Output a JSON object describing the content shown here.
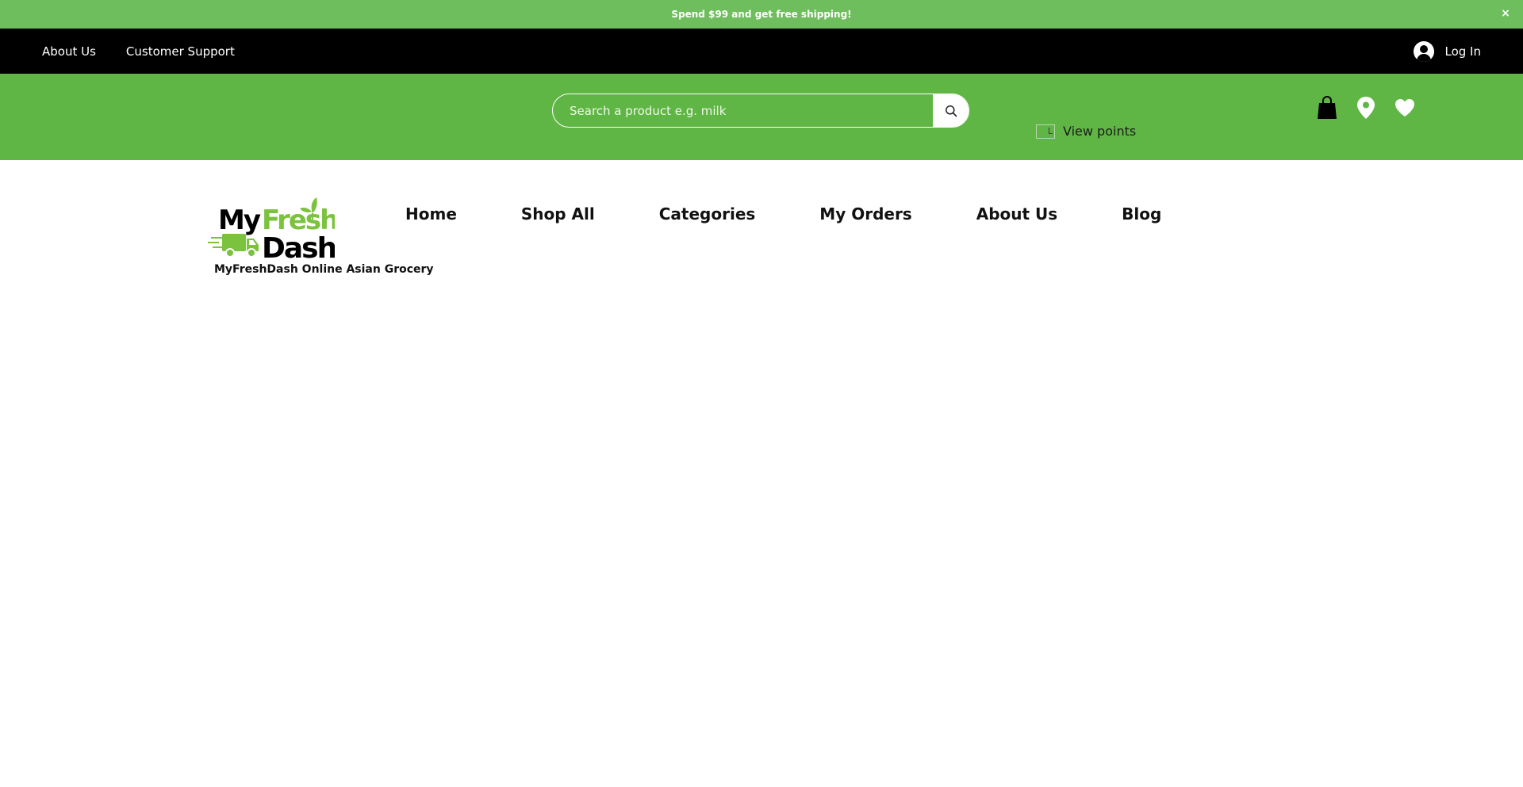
{
  "announcement": {
    "text": "Spend $99 and get free shipping!",
    "close_label": "×"
  },
  "topbar": {
    "links": [
      "About Us",
      "Customer Support"
    ],
    "login_label": "Log In"
  },
  "search": {
    "placeholder": "Search a product e.g. milk"
  },
  "points": {
    "broken_image_alt": "L",
    "label": "View points"
  },
  "header_icons": [
    "shopping-bag-icon",
    "location-pin-icon",
    "heart-icon"
  ],
  "logo": {
    "word_my": "My",
    "word_fresh": "Fresh",
    "word_dash": "Dash"
  },
  "tagline": "MyFreshDash Online Asian Grocery",
  "nav": {
    "items": [
      "Home",
      "Shop All",
      "Categories",
      "My Orders",
      "About Us",
      "Blog"
    ]
  },
  "colors": {
    "announcement_bg": "#6fbe5e",
    "band_bg": "#5fb644",
    "topbar_bg": "#000000",
    "logo_green": "#7bc23e"
  }
}
